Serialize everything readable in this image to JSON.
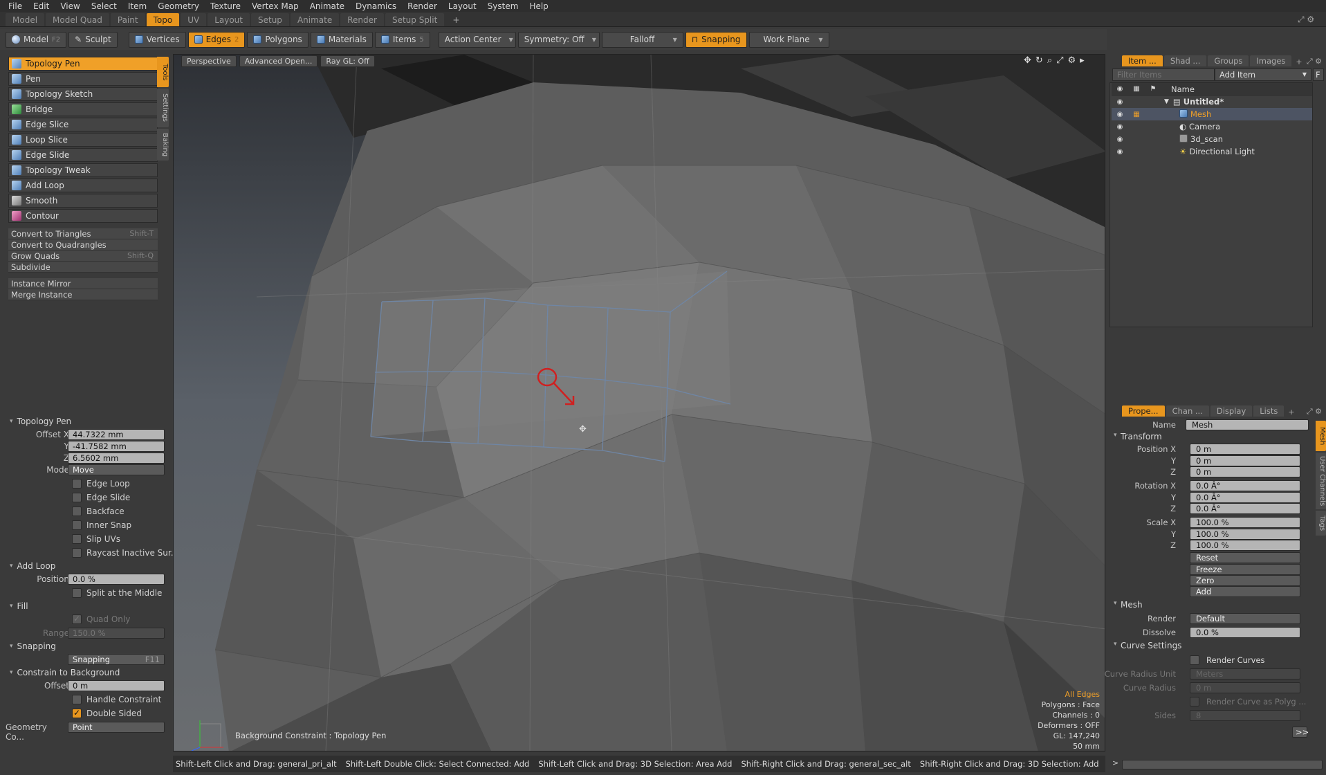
{
  "menubar": [
    "File",
    "Edit",
    "View",
    "Select",
    "Item",
    "Geometry",
    "Texture",
    "Vertex Map",
    "Animate",
    "Dynamics",
    "Render",
    "Layout",
    "System",
    "Help"
  ],
  "layout_tabs": [
    "Model",
    "Model Quad",
    "Paint",
    "Topo",
    "UV",
    "Layout",
    "Setup",
    "Animate",
    "Render",
    "Setup Split"
  ],
  "active_layout_tab": "Topo",
  "toolbar": {
    "model": "Model",
    "model_key": "F2",
    "sculpt": "Sculpt",
    "vertices": "Vertices",
    "edges": "Edges",
    "edges_key": "2",
    "polygons": "Polygons",
    "materials": "Materials",
    "items": "Items",
    "items_key": "5",
    "action_center": "Action Center",
    "symmetry": "Symmetry: Off",
    "falloff": "Falloff",
    "snapping": "Snapping",
    "work_plane": "Work Plane"
  },
  "tools": [
    "Topology Pen",
    "Pen",
    "Topology Sketch",
    "Bridge",
    "Edge Slice",
    "Loop Slice",
    "Edge Slide",
    "Topology Tweak",
    "Add Loop",
    "Smooth",
    "Contour"
  ],
  "commands": [
    {
      "label": "Convert to Triangles",
      "key": "Shift-T"
    },
    {
      "label": "Convert to Quadrangles",
      "key": ""
    },
    {
      "label": "Grow Quads",
      "key": "Shift-Q"
    },
    {
      "label": "Subdivide",
      "key": ""
    }
  ],
  "commands2": [
    "Instance Mirror",
    "Merge Instance"
  ],
  "side_tabs": [
    "Tools",
    "Settings",
    "Baking"
  ],
  "tool_props": {
    "section": "Topology Pen",
    "offset_x_label": "Offset X",
    "offset_x": "44.7322 mm",
    "y_label": "Y",
    "offset_y": "-41.7582 mm",
    "z_label": "Z",
    "offset_z": "6.5602 mm",
    "mode_label": "Mode",
    "mode": "Move",
    "checks": [
      "Edge Loop",
      "Edge Slide",
      "Backface",
      "Inner Snap",
      "Slip UVs",
      "Raycast Inactive Sur..."
    ],
    "add_loop": "Add Loop",
    "position_label": "Position",
    "position": "0.0 %",
    "split_middle": "Split at the Middle",
    "fill": "Fill",
    "quad_only": "Quad Only",
    "range_label": "Range",
    "range": "150.0 %",
    "snapping_sec": "Snapping",
    "snapping_btn": "Snapping",
    "snapping_key": "F11",
    "constrain_sec": "Constrain to Background",
    "offset_label": "Offset",
    "offset": "0 m",
    "handle_constraint": "Handle Constraint",
    "double_sided": "Double Sided",
    "geometry_label": "Geometry Co...",
    "geometry": "Point"
  },
  "viewport": {
    "view": "Perspective",
    "shading": "Advanced Open...",
    "raygl": "Ray GL: Off",
    "stats": {
      "mode": "All Edges",
      "polygons": "Polygons : Face",
      "channels": "Channels : 0",
      "deformers": "Deformers : OFF",
      "gl": "GL: 147,240",
      "scale": "50 mm"
    },
    "hint": "Background Constraint : Topology Pen"
  },
  "status_items": [
    "Shift-Left Click and Drag: general_pri_alt",
    "Shift-Left Double Click: Select Connected: Add",
    "Shift-Left Click and Drag: 3D Selection: Area Add",
    "Shift-Right Click and Drag: general_sec_alt",
    "Shift-Right Click and Drag: 3D Selection: Add",
    "..."
  ],
  "items_panel": {
    "tabs": [
      "Item ...",
      "Shad ...",
      "Groups",
      "Images"
    ],
    "filter_placeholder": "Filter Items",
    "add_item": "Add Item",
    "f_btn": "F",
    "name_header": "Name",
    "items": [
      "Untitled*",
      "Mesh",
      "Camera",
      "3d_scan",
      "Directional Light"
    ]
  },
  "props_panel": {
    "tabs": [
      "Prope...",
      "Chan ...",
      "Display",
      "Lists"
    ],
    "name_label": "Name",
    "name": "Mesh",
    "transform": "Transform",
    "pos_label": "Position X",
    "pos": [
      "0 m",
      "0 m",
      "0 m"
    ],
    "rot_label": "Rotation X",
    "rot": [
      "0.0 Â°",
      "0.0 Â°",
      "0.0 Â°"
    ],
    "scale_label": "Scale X",
    "scale": [
      "100.0 %",
      "100.0 %",
      "100.0 %"
    ],
    "y": "Y",
    "z": "Z",
    "actions": [
      "Reset",
      "Freeze",
      "Zero",
      "Add"
    ],
    "mesh_sec": "Mesh",
    "render_label": "Render",
    "render": "Default",
    "dissolve_label": "Dissolve",
    "dissolve": "0.0 %",
    "curve_sec": "Curve Settings",
    "render_curves": "Render Curves",
    "cru_label": "Curve Radius Unit",
    "cru": "Meters",
    "cr_label": "Curve Radius",
    "cr": "0 m",
    "rcap": "Render Curve as Polyg ...",
    "sides_label": "Sides",
    "sides": "8",
    "more": ">>",
    "side_tabs": [
      "Mesh",
      "User Channels",
      "Tags"
    ]
  }
}
